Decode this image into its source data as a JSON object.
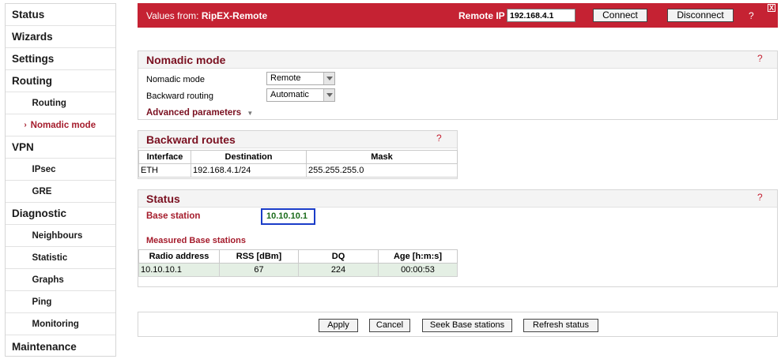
{
  "sidebar": {
    "status": "Status",
    "wizards": "Wizards",
    "settings": "Settings",
    "routing": "Routing",
    "routing_sub": "Routing",
    "nomadic_mode": "Nomadic mode",
    "active_marker": "›",
    "vpn": "VPN",
    "ipsec": "IPsec",
    "gre": "GRE",
    "diagnostic": "Diagnostic",
    "neighbours": "Neighbours",
    "statistic": "Statistic",
    "graphs": "Graphs",
    "ping": "Ping",
    "monitoring": "Monitoring",
    "maintenance": "Maintenance"
  },
  "header": {
    "values_from_prefix": "Values from: ",
    "device_name": "RipEX-Remote",
    "remote_ip_label": "Remote IP",
    "remote_ip_value": "192.168.4.1",
    "connect_label": "Connect",
    "disconnect_label": "Disconnect",
    "help": "?",
    "close": "X"
  },
  "nomadic": {
    "title": "Nomadic mode",
    "help": "?",
    "mode_label": "Nomadic mode",
    "mode_value": "Remote",
    "backward_routing_label": "Backward routing",
    "backward_routing_value": "Automatic",
    "advanced_label": "Advanced parameters",
    "advanced_arrow": "▼"
  },
  "backward_routes": {
    "title": "Backward routes",
    "help": "?",
    "columns": [
      "Interface",
      "Destination",
      "Mask"
    ],
    "rows": [
      [
        "ETH",
        "192.168.4.1/24",
        "255.255.255.0"
      ]
    ]
  },
  "status": {
    "title": "Status",
    "help": "?",
    "base_station_label": "Base station",
    "base_station_value": "10.10.10.1",
    "measured_title": "Measured Base stations",
    "columns": [
      "Radio address",
      "RSS [dBm]",
      "DQ",
      "Age [h:m:s]"
    ],
    "rows": [
      [
        "10.10.10.1",
        "67",
        "224",
        "00:00:53"
      ]
    ]
  },
  "footer": {
    "apply": "Apply",
    "cancel": "Cancel",
    "seek": "Seek Base stations",
    "refresh": "Refresh status"
  },
  "colors": {
    "brand": "#c52233",
    "panel_title": "#7a1020",
    "highlight_row": "#e4efe4",
    "base_station_border": "#1a3cc8",
    "base_station_text": "#1a6b1a"
  }
}
